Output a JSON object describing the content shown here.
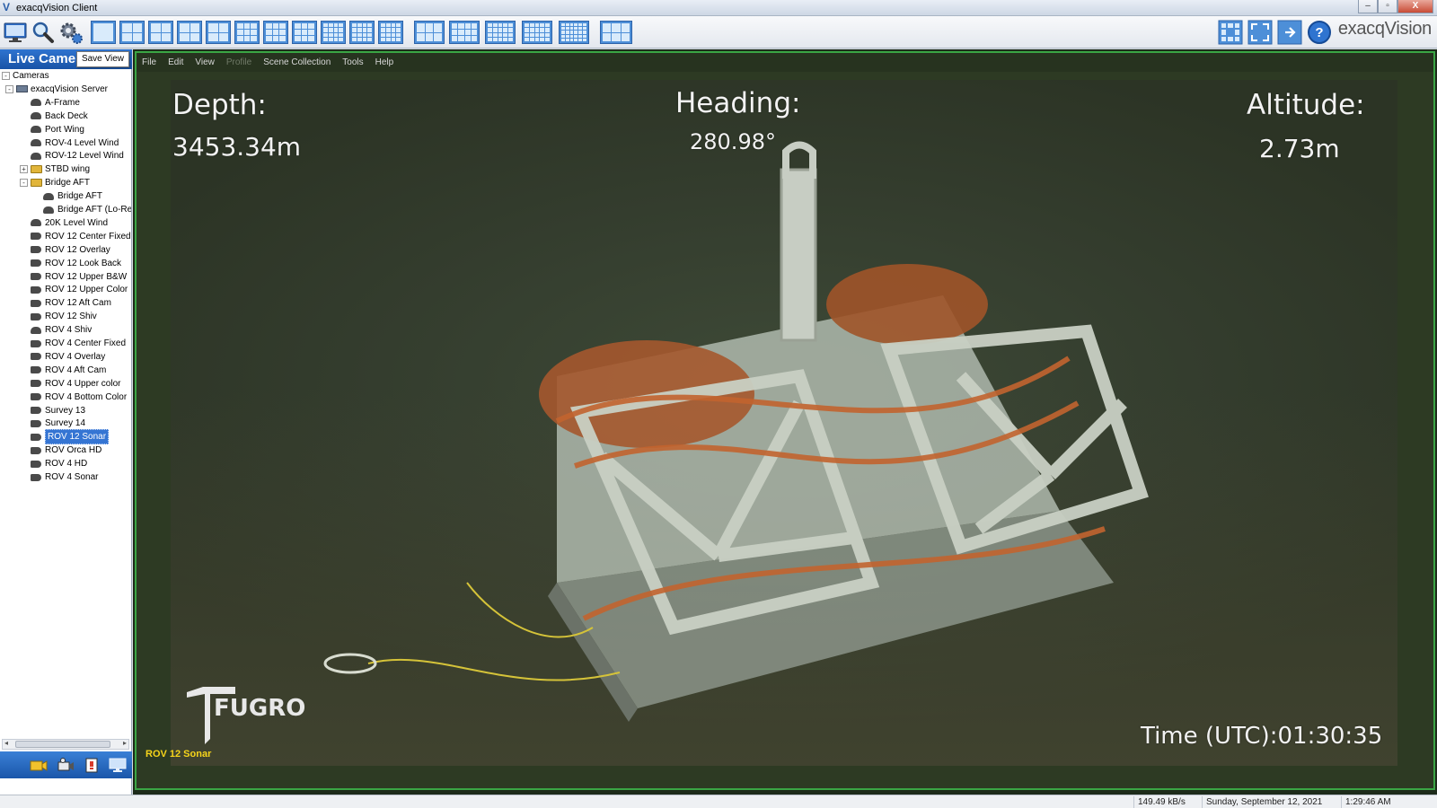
{
  "window": {
    "title": "exacqVision Client",
    "buttons": [
      "–",
      "▫",
      "X"
    ]
  },
  "toolbar": {
    "brand": "exacqVision"
  },
  "sidebar": {
    "header": "Live Cameras",
    "save_view": "Save View",
    "tree": [
      {
        "label": "Cameras",
        "level": 0,
        "type": "root",
        "expander": "-"
      },
      {
        "label": "exacqVision Server",
        "level": 1,
        "type": "server",
        "expander": "-"
      },
      {
        "label": "A-Frame",
        "level": 2,
        "type": "dome"
      },
      {
        "label": "Back Deck",
        "level": 2,
        "type": "dome"
      },
      {
        "label": "Port Wing",
        "level": 2,
        "type": "dome"
      },
      {
        "label": "ROV-4 Level Wind",
        "level": 2,
        "type": "dome"
      },
      {
        "label": "ROV-12 Level Wind",
        "level": 2,
        "type": "dome"
      },
      {
        "label": "STBD wing",
        "level": 2,
        "type": "folder",
        "expander": "+"
      },
      {
        "label": "Bridge AFT",
        "level": 2,
        "type": "folder",
        "expander": "-"
      },
      {
        "label": "Bridge AFT",
        "level": 3,
        "type": "dome"
      },
      {
        "label": "Bridge AFT (Lo-Res)",
        "level": 3,
        "type": "dome"
      },
      {
        "label": "20K Level Wind",
        "level": 2,
        "type": "dome"
      },
      {
        "label": "ROV 12  Center Fixed",
        "level": 2,
        "type": "cam"
      },
      {
        "label": "ROV 12 Overlay",
        "level": 2,
        "type": "cam"
      },
      {
        "label": "ROV 12 Look Back",
        "level": 2,
        "type": "cam"
      },
      {
        "label": "ROV 12 Upper B&W",
        "level": 2,
        "type": "cam"
      },
      {
        "label": "ROV 12 Upper Color",
        "level": 2,
        "type": "cam"
      },
      {
        "label": "ROV 12 Aft Cam",
        "level": 2,
        "type": "cam"
      },
      {
        "label": "ROV 12 Shiv",
        "level": 2,
        "type": "cam"
      },
      {
        "label": "ROV 4 Shiv",
        "level": 2,
        "type": "dome"
      },
      {
        "label": "ROV 4 Center Fixed",
        "level": 2,
        "type": "cam"
      },
      {
        "label": "ROV 4 Overlay",
        "level": 2,
        "type": "cam"
      },
      {
        "label": "ROV 4 Aft Cam",
        "level": 2,
        "type": "cam"
      },
      {
        "label": "ROV 4 Upper color",
        "level": 2,
        "type": "cam"
      },
      {
        "label": "ROV 4 Bottom Color",
        "level": 2,
        "type": "cam"
      },
      {
        "label": "Survey 13",
        "level": 2,
        "type": "cam"
      },
      {
        "label": "Survey 14",
        "level": 2,
        "type": "cam"
      },
      {
        "label": "ROV 12 Sonar",
        "level": 2,
        "type": "cam",
        "selected": true
      },
      {
        "label": "ROV Orca HD",
        "level": 2,
        "type": "cam"
      },
      {
        "label": "ROV 4 HD",
        "level": 2,
        "type": "cam"
      },
      {
        "label": "ROV 4 Sonar",
        "level": 2,
        "type": "cam"
      }
    ]
  },
  "menu": {
    "items": [
      {
        "label": "File",
        "disabled": false
      },
      {
        "label": "Edit",
        "disabled": false
      },
      {
        "label": "View",
        "disabled": false
      },
      {
        "label": "Profile",
        "disabled": true
      },
      {
        "label": "Scene Collection",
        "disabled": false
      },
      {
        "label": "Tools",
        "disabled": false
      },
      {
        "label": "Help",
        "disabled": false
      }
    ]
  },
  "video": {
    "depth_label": "Depth:",
    "depth_value": "3453.34m",
    "heading_label": "Heading:",
    "heading_value": "280.98°",
    "altitude_label": "Altitude:",
    "altitude_value": "2.73m",
    "time": "Time (UTC):01:30:35",
    "logo": "FUGRO",
    "camera_label": "ROV 12 Sonar"
  },
  "status": {
    "bandwidth": "149.49 kB/s",
    "date": "Sunday, September 12, 2021",
    "time": "1:29:46 AM"
  },
  "colors": {
    "accent_blue": "#2f74d0",
    "frame_green": "#3aa544",
    "camera_label_yellow": "#f6d41a"
  }
}
